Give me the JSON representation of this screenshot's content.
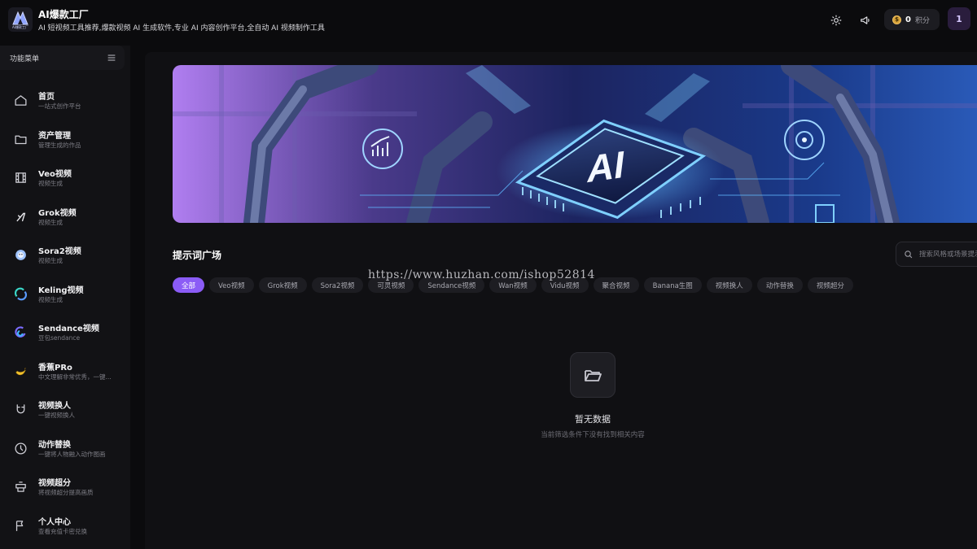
{
  "header": {
    "logo_text": "AI爆款工厂",
    "title": "AI爆款工厂",
    "subtitle": "AI 短视频工具推荐,爆款视频 AI 生成软件,专业 AI 内容创作平台,全自动 AI 视频制作工具",
    "points_value": "0",
    "points_unit": "积分",
    "coin_symbol": "$",
    "avatar_initial": "1"
  },
  "sidebar": {
    "menu_title": "功能菜单",
    "items": [
      {
        "label": "首页",
        "sub": "一站式创作平台",
        "icon": "home-icon"
      },
      {
        "label": "资产管理",
        "sub": "管理生成的作品",
        "icon": "folder-icon"
      },
      {
        "label": "Veo视频",
        "sub": "视频生成",
        "icon": "film-icon"
      },
      {
        "label": "Grok视频",
        "sub": "视频生成",
        "icon": "grok-icon"
      },
      {
        "label": "Sora2视频",
        "sub": "视频生成",
        "icon": "sora-icon"
      },
      {
        "label": "Keling视频",
        "sub": "视频生成",
        "icon": "keling-icon"
      },
      {
        "label": "Sendance视频",
        "sub": "豆包sendance",
        "icon": "sendance-icon"
      },
      {
        "label": "香蕉PRo",
        "sub": "中文理解非常优秀，一键...",
        "icon": "banana-icon"
      },
      {
        "label": "视频换人",
        "sub": "一键视频换人",
        "icon": "magnet-icon"
      },
      {
        "label": "动作替换",
        "sub": "一键将人物融入动作图画",
        "icon": "clock-icon"
      },
      {
        "label": "视频超分",
        "sub": "将视频超分提高画质",
        "icon": "upscale-icon"
      },
      {
        "label": "个人中心",
        "sub": "查看充值卡密兑换",
        "icon": "flag-icon"
      }
    ]
  },
  "banner": {
    "chip_text": "AI"
  },
  "main": {
    "section_title": "提示词广场",
    "search_placeholder": "搜索风格或场景提示词",
    "tabs": [
      "全部",
      "Veo视频",
      "Grok视频",
      "Sora2视频",
      "可灵视频",
      "Sendance视频",
      "Wan视频",
      "Vidu视频",
      "聚合视频",
      "Banana生图",
      "视频换人",
      "动作替换",
      "视频超分"
    ],
    "active_tab_index": 0,
    "watermark": "https://www.huzhan.com/ishop52814",
    "empty_title": "暂无数据",
    "empty_subtitle": "当前筛选条件下没有找到相关内容"
  },
  "colors": {
    "accent": "#8b5cf6",
    "background": "#0b0b0d",
    "sidebar": "#121215",
    "coin": "#d6a23a"
  }
}
